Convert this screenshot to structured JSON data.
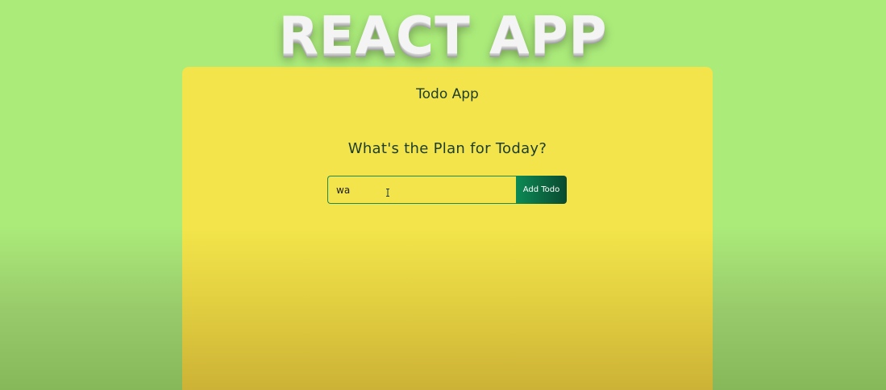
{
  "banner": {
    "title": "REACT APP"
  },
  "app": {
    "title": "Todo App",
    "heading": "What's the Plan for Today?",
    "form": {
      "input_value": "wa",
      "button_label": "Add Todo"
    }
  },
  "colors": {
    "background": "#abeb7a",
    "card": "#f2e44a",
    "button_start": "#0c8a55",
    "button_end": "#0a4a30",
    "text": "#1d3d2c"
  },
  "icons": {
    "cursor": "text-cursor-icon"
  }
}
